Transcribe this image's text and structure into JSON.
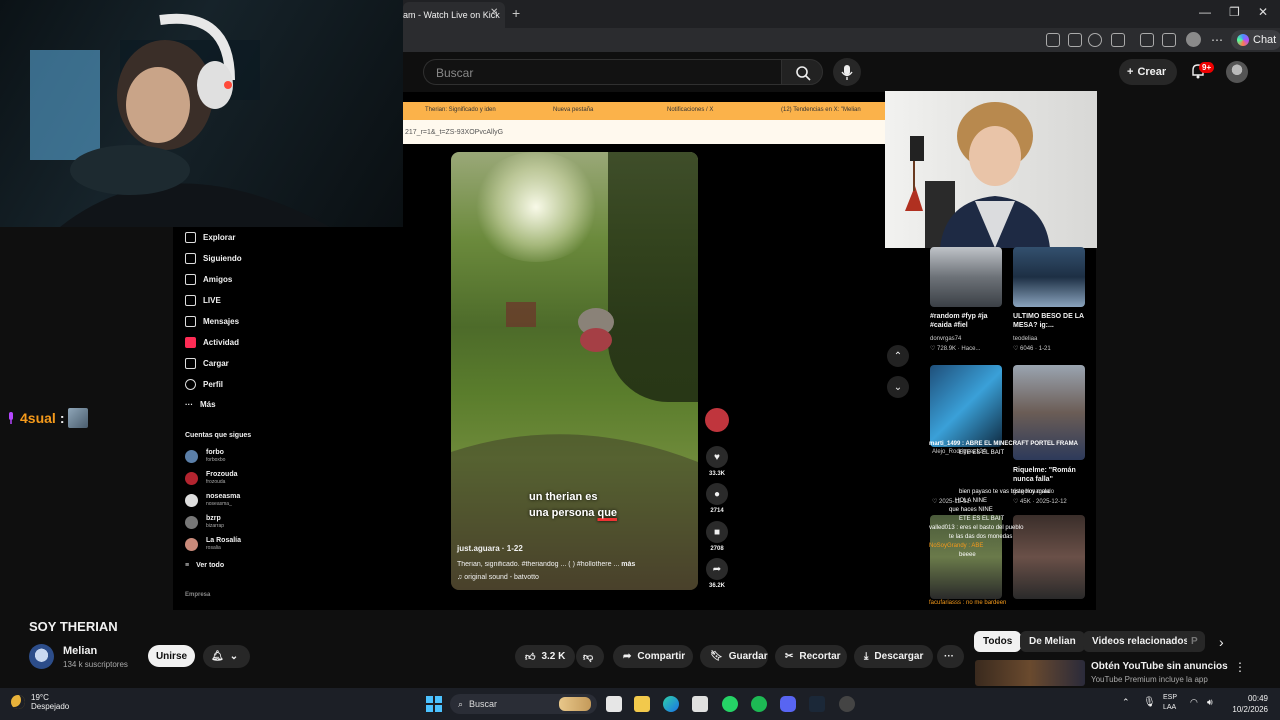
{
  "browser": {
    "tab_title": "am - Watch Live on Kick",
    "chat_label": "Chat"
  },
  "youtube": {
    "search_placeholder": "Buscar",
    "create_label": "Crear",
    "notification_badge": "9+",
    "video_title": "SOY THERIAN",
    "channel_name": "Melian",
    "channel_subs": "134 k suscriptores",
    "join_label": "Unirse",
    "likes": "3.2 K",
    "share_label": "Compartir",
    "save_label": "Guardar",
    "clip_label": "Recortar",
    "download_label": "Descargar",
    "chips": [
      "Todos",
      "De Melian",
      "Videos relacionados",
      "P"
    ],
    "ad_title": "Obtén YouTube sin anuncios",
    "ad_sub": "YouTube Premium incluye la app"
  },
  "stream": {
    "chat_user": "4sual",
    "inner_tabs": [
      "Therian: Significado y iden",
      "Nueva pestaña",
      "Notificaciones / X",
      "(12) Tendencias en X: \"Melian"
    ],
    "inner_url": "217_r=1&_t=ZS-93XOPvcAllyG",
    "tiktok_menu": [
      "Explorar",
      "Siguiendo",
      "Amigos",
      "LIVE",
      "Mensajes",
      "Actividad",
      "Cargar",
      "Perfil",
      "Más"
    ],
    "following_header": "Cuentas que sigues",
    "following": [
      {
        "name": "forbo",
        "user": "forboxbo"
      },
      {
        "name": "Frozouda",
        "user": "frozouda"
      },
      {
        "name": "noseasma",
        "user": "noseasma_"
      },
      {
        "name": "bzrp",
        "user": "bizarrap"
      },
      {
        "name": "La Rosalía",
        "user": "rosalia"
      }
    ],
    "see_all": "Ver todo",
    "company": "Empresa",
    "caption_line1": "un therian es",
    "caption_line2a": "una persona ",
    "caption_line2b": "que",
    "video_user": "just.aguara · 1-22",
    "video_desc": "Therian, significado. #theriandog ... ( ) #hollothere ...",
    "video_more": "más",
    "video_sound": "♫ original sound - batvotto",
    "counts": {
      "likes": "33.3K",
      "comments": "2714",
      "saves": "2708",
      "shares": "36.2K"
    },
    "grid": [
      {
        "caption": "#random #fyp #ja #caida #fiel",
        "user": "donvrgas74",
        "stats": "♡ 728.9K · Hace..."
      },
      {
        "caption": "ULTIMO BESO DE LA MESA? ig:...",
        "user": "teodeliaa",
        "stats": "♡ 6046 · 1-21"
      },
      {
        "caption": "",
        "user": "Alejo_Rodriguez124",
        "stats": "♡ 2025-12-31"
      },
      {
        "caption": "Riquelme: \"Román nunca falla\"",
        "user": "gs.golosagrado",
        "stats": "♡ 45K · 2025-12-12"
      }
    ],
    "kick_chat": [
      "marti_1499 : ABRE EL MINECRAFT PORTEL FRAMA",
      "ETE ES EL BAIT",
      "bien payaso te vas triste hoy mala",
      "HOLA NINE",
      "que haces NINE",
      "ETE ES EL BAIT",
      "valled013 : eres el basto del pueblo",
      "te las das dos monedas",
      "NoSoyGrandy : ABE",
      "beeee"
    ],
    "kick_last": "facufariasss : no me bardeen"
  },
  "taskbar": {
    "temp": "19°C",
    "weather": "Despejado",
    "search": "Buscar",
    "lang1": "ESP",
    "lang2": "LAA",
    "time": "00:49",
    "date": "10/2/2026"
  },
  "colors": {
    "yt_bg": "#0f0f0f",
    "kick_chat_name": "#f59a1b",
    "inner_tab_bar": "#fbb24a",
    "badge": "#e00000"
  }
}
